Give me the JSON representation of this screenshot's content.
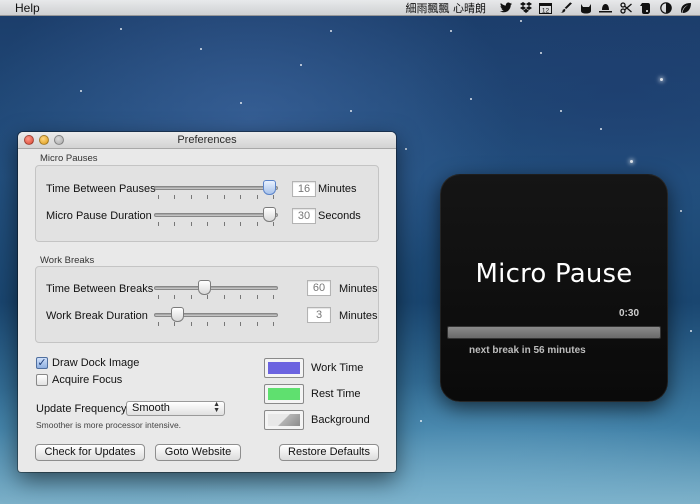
{
  "menubar": {
    "app_menu": "Help",
    "username": "細雨飄飄 心晴朗",
    "status_icons": [
      "twitter-icon",
      "dropbox-icon",
      "calendar-icon",
      "brush-icon",
      "cat-icon",
      "bowler-hat-icon",
      "scissors-icon",
      "evernote-icon",
      "moon-icon",
      "leaf-icon"
    ],
    "calendar_day": "12"
  },
  "preferences": {
    "title": "Preferences",
    "micro_pauses": {
      "section_label": "Micro Pauses",
      "time_between": {
        "label": "Time Between Pauses",
        "value": "16",
        "unit": "Minutes",
        "slider_fraction": 0.96
      },
      "duration": {
        "label": "Micro Pause Duration",
        "value": "30",
        "unit": "Seconds",
        "slider_fraction": 0.96
      }
    },
    "work_breaks": {
      "section_label": "Work Breaks",
      "time_between": {
        "label": "Time Between Breaks",
        "value": "60",
        "unit": "Minutes",
        "slider_fraction": 0.4
      },
      "duration": {
        "label": "Work Break Duration",
        "value": "3",
        "unit": "Minutes",
        "slider_fraction": 0.16
      }
    },
    "draw_dock_image": {
      "label": "Draw Dock Image",
      "checked": true
    },
    "acquire_focus": {
      "label": "Acquire Focus",
      "checked": false
    },
    "update_frequency": {
      "label": "Update Frequency",
      "value": "Smooth",
      "hint": "Smoother is more processor intensive."
    },
    "colors": {
      "work_time": {
        "label": "Work Time",
        "color": "#6b63e0"
      },
      "rest_time": {
        "label": "Rest Time",
        "color": "#5fe06f"
      },
      "background": {
        "label": "Background",
        "color": "#b4b4b4"
      }
    },
    "buttons": {
      "check_updates": "Check for Updates",
      "goto_website": "Goto Website",
      "restore_defaults": "Restore Defaults"
    }
  },
  "overlay": {
    "title": "Micro Pause",
    "time": "0:30",
    "progress_fraction": 1.0,
    "next_break": "next break in 56 minutes"
  }
}
